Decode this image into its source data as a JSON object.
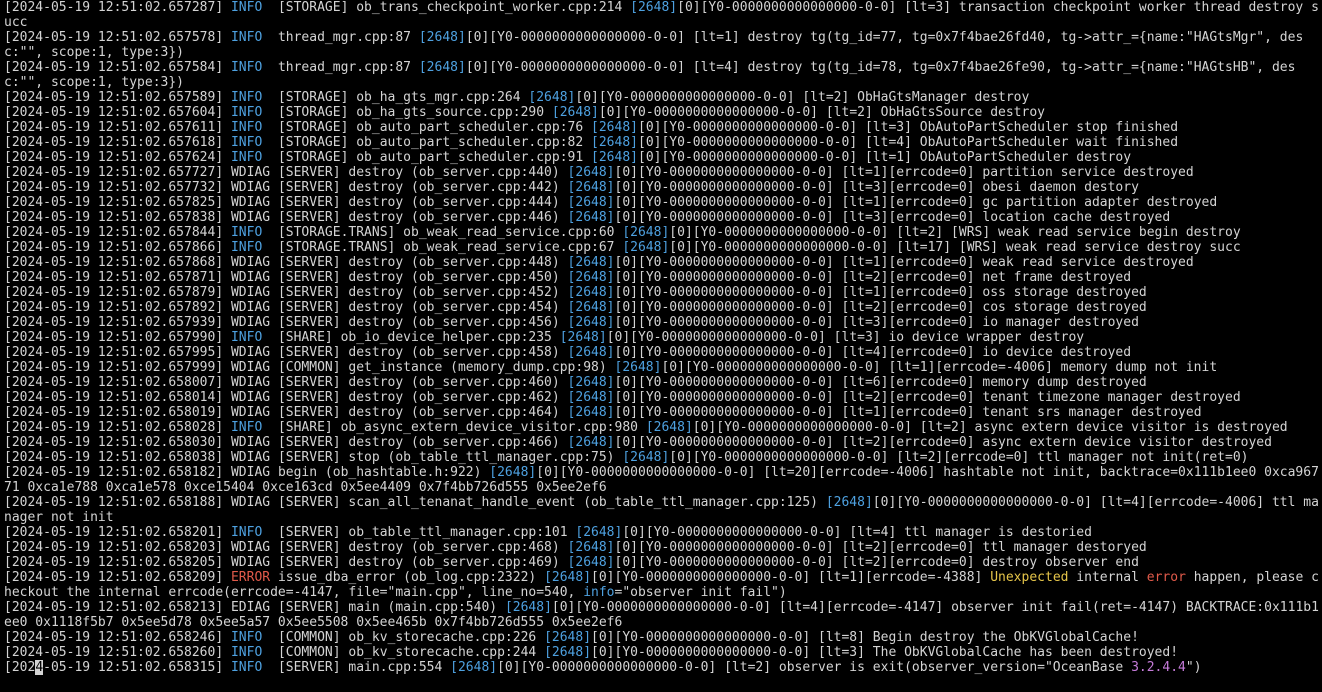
{
  "colors": {
    "background": "#000000",
    "text": "#d4d4d4",
    "info": "#4ea1e0",
    "error": "#e05a4a",
    "highlight_yellow": "#e5c54a",
    "highlight_purple": "#c57bd9"
  },
  "lines": [
    {
      "ts": "[2024-05-19 12:51:02.657287]",
      "lvl": "INFO",
      "lvlClass": "info",
      "pad": "  ",
      "pre": "[STORAGE] ob_trans_checkpoint_worker.cpp:214 ",
      "tid": "[2648]",
      "post": "[0][Y0-0000000000000000-0-0] [lt=3] transaction checkpoint worker thread destroy succ"
    },
    {
      "ts": "[2024-05-19 12:51:02.657578]",
      "lvl": "INFO",
      "lvlClass": "info",
      "pad": "  ",
      "pre": "thread_mgr.cpp:87 ",
      "tid": "[2648]",
      "post": "[0][Y0-0000000000000000-0-0] [lt=1] destroy tg(tg_id=77, tg=0x7f4bae26fd40, tg->attr_={name:\"HAGtsMgr\", desc:\"\", scope:1, type:3})"
    },
    {
      "ts": "[2024-05-19 12:51:02.657584]",
      "lvl": "INFO",
      "lvlClass": "info",
      "pad": "  ",
      "pre": "thread_mgr.cpp:87 ",
      "tid": "[2648]",
      "post": "[0][Y0-0000000000000000-0-0] [lt=4] destroy tg(tg_id=78, tg=0x7f4bae26fe90, tg->attr_={name:\"HAGtsHB\", desc:\"\", scope:1, type:3})"
    },
    {
      "ts": "[2024-05-19 12:51:02.657589]",
      "lvl": "INFO",
      "lvlClass": "info",
      "pad": "  ",
      "pre": "[STORAGE] ob_ha_gts_mgr.cpp:264 ",
      "tid": "[2648]",
      "post": "[0][Y0-0000000000000000-0-0] [lt=2] ObHaGtsManager destroy"
    },
    {
      "ts": "[2024-05-19 12:51:02.657604]",
      "lvl": "INFO",
      "lvlClass": "info",
      "pad": "  ",
      "pre": "[STORAGE] ob_ha_gts_source.cpp:290 ",
      "tid": "[2648]",
      "post": "[0][Y0-0000000000000000-0-0] [lt=2] ObHaGtsSource destroy"
    },
    {
      "ts": "[2024-05-19 12:51:02.657611]",
      "lvl": "INFO",
      "lvlClass": "info",
      "pad": "  ",
      "pre": "[STORAGE] ob_auto_part_scheduler.cpp:76 ",
      "tid": "[2648]",
      "post": "[0][Y0-0000000000000000-0-0] [lt=3] ObAutoPartScheduler stop finished"
    },
    {
      "ts": "[2024-05-19 12:51:02.657618]",
      "lvl": "INFO",
      "lvlClass": "info",
      "pad": "  ",
      "pre": "[STORAGE] ob_auto_part_scheduler.cpp:82 ",
      "tid": "[2648]",
      "post": "[0][Y0-0000000000000000-0-0] [lt=4] ObAutoPartScheduler wait finished"
    },
    {
      "ts": "[2024-05-19 12:51:02.657624]",
      "lvl": "INFO",
      "lvlClass": "info",
      "pad": "  ",
      "pre": "[STORAGE] ob_auto_part_scheduler.cpp:91 ",
      "tid": "[2648]",
      "post": "[0][Y0-0000000000000000-0-0] [lt=1] ObAutoPartScheduler destroy"
    },
    {
      "ts": "[2024-05-19 12:51:02.657727]",
      "lvl": "WDIAG",
      "lvlClass": "wdiag",
      "pad": " ",
      "pre": "[SERVER] destroy (ob_server.cpp:440) ",
      "tid": "[2648]",
      "post": "[0][Y0-0000000000000000-0-0] [lt=1][errcode=0] partition service destroyed"
    },
    {
      "ts": "[2024-05-19 12:51:02.657732]",
      "lvl": "WDIAG",
      "lvlClass": "wdiag",
      "pad": " ",
      "pre": "[SERVER] destroy (ob_server.cpp:442) ",
      "tid": "[2648]",
      "post": "[0][Y0-0000000000000000-0-0] [lt=3][errcode=0] obesi daemon destory"
    },
    {
      "ts": "[2024-05-19 12:51:02.657825]",
      "lvl": "WDIAG",
      "lvlClass": "wdiag",
      "pad": " ",
      "pre": "[SERVER] destroy (ob_server.cpp:444) ",
      "tid": "[2648]",
      "post": "[0][Y0-0000000000000000-0-0] [lt=1][errcode=0] gc partition adapter destroyed"
    },
    {
      "ts": "[2024-05-19 12:51:02.657838]",
      "lvl": "WDIAG",
      "lvlClass": "wdiag",
      "pad": " ",
      "pre": "[SERVER] destroy (ob_server.cpp:446) ",
      "tid": "[2648]",
      "post": "[0][Y0-0000000000000000-0-0] [lt=3][errcode=0] location cache destroyed"
    },
    {
      "ts": "[2024-05-19 12:51:02.657844]",
      "lvl": "INFO",
      "lvlClass": "info",
      "pad": "  ",
      "pre": "[STORAGE.TRANS] ob_weak_read_service.cpp:60 ",
      "tid": "[2648]",
      "post": "[0][Y0-0000000000000000-0-0] [lt=2] [WRS] weak read service begin destroy"
    },
    {
      "ts": "[2024-05-19 12:51:02.657866]",
      "lvl": "INFO",
      "lvlClass": "info",
      "pad": "  ",
      "pre": "[STORAGE.TRANS] ob_weak_read_service.cpp:67 ",
      "tid": "[2648]",
      "post": "[0][Y0-0000000000000000-0-0] [lt=17] [WRS] weak read service destroy succ"
    },
    {
      "ts": "[2024-05-19 12:51:02.657868]",
      "lvl": "WDIAG",
      "lvlClass": "wdiag",
      "pad": " ",
      "pre": "[SERVER] destroy (ob_server.cpp:448) ",
      "tid": "[2648]",
      "post": "[0][Y0-0000000000000000-0-0] [lt=1][errcode=0] weak read service destroyed"
    },
    {
      "ts": "[2024-05-19 12:51:02.657871]",
      "lvl": "WDIAG",
      "lvlClass": "wdiag",
      "pad": " ",
      "pre": "[SERVER] destroy (ob_server.cpp:450) ",
      "tid": "[2648]",
      "post": "[0][Y0-0000000000000000-0-0] [lt=2][errcode=0] net frame destroyed"
    },
    {
      "ts": "[2024-05-19 12:51:02.657879]",
      "lvl": "WDIAG",
      "lvlClass": "wdiag",
      "pad": " ",
      "pre": "[SERVER] destroy (ob_server.cpp:452) ",
      "tid": "[2648]",
      "post": "[0][Y0-0000000000000000-0-0] [lt=1][errcode=0] oss storage destroyed"
    },
    {
      "ts": "[2024-05-19 12:51:02.657892]",
      "lvl": "WDIAG",
      "lvlClass": "wdiag",
      "pad": " ",
      "pre": "[SERVER] destroy (ob_server.cpp:454) ",
      "tid": "[2648]",
      "post": "[0][Y0-0000000000000000-0-0] [lt=2][errcode=0] cos storage destroyed"
    },
    {
      "ts": "[2024-05-19 12:51:02.657939]",
      "lvl": "WDIAG",
      "lvlClass": "wdiag",
      "pad": " ",
      "pre": "[SERVER] destroy (ob_server.cpp:456) ",
      "tid": "[2648]",
      "post": "[0][Y0-0000000000000000-0-0] [lt=3][errcode=0] io manager destroyed"
    },
    {
      "ts": "[2024-05-19 12:51:02.657990]",
      "lvl": "INFO",
      "lvlClass": "info",
      "pad": "  ",
      "pre": "[SHARE] ob_io_device_helper.cpp:235 ",
      "tid": "[2648]",
      "post": "[0][Y0-0000000000000000-0-0] [lt=3] io device wrapper destroy"
    },
    {
      "ts": "[2024-05-19 12:51:02.657995]",
      "lvl": "WDIAG",
      "lvlClass": "wdiag",
      "pad": " ",
      "pre": "[SERVER] destroy (ob_server.cpp:458) ",
      "tid": "[2648]",
      "post": "[0][Y0-0000000000000000-0-0] [lt=4][errcode=0] io device destroyed"
    },
    {
      "ts": "[2024-05-19 12:51:02.657999]",
      "lvl": "WDIAG",
      "lvlClass": "wdiag",
      "pad": " ",
      "pre": "[COMMON] get_instance (memory_dump.cpp:98) ",
      "tid": "[2648]",
      "post": "[0][Y0-0000000000000000-0-0] [lt=1][errcode=-4006] memory dump not init"
    },
    {
      "ts": "[2024-05-19 12:51:02.658007]",
      "lvl": "WDIAG",
      "lvlClass": "wdiag",
      "pad": " ",
      "pre": "[SERVER] destroy (ob_server.cpp:460) ",
      "tid": "[2648]",
      "post": "[0][Y0-0000000000000000-0-0] [lt=6][errcode=0] memory dump destroyed"
    },
    {
      "ts": "[2024-05-19 12:51:02.658014]",
      "lvl": "WDIAG",
      "lvlClass": "wdiag",
      "pad": " ",
      "pre": "[SERVER] destroy (ob_server.cpp:462) ",
      "tid": "[2648]",
      "post": "[0][Y0-0000000000000000-0-0] [lt=2][errcode=0] tenant timezone manager destroyed"
    },
    {
      "ts": "[2024-05-19 12:51:02.658019]",
      "lvl": "WDIAG",
      "lvlClass": "wdiag",
      "pad": " ",
      "pre": "[SERVER] destroy (ob_server.cpp:464) ",
      "tid": "[2648]",
      "post": "[0][Y0-0000000000000000-0-0] [lt=1][errcode=0] tenant srs manager destroyed"
    },
    {
      "ts": "[2024-05-19 12:51:02.658028]",
      "lvl": "INFO",
      "lvlClass": "info",
      "pad": "  ",
      "pre": "[SHARE] ob_async_extern_device_visitor.cpp:980 ",
      "tid": "[2648]",
      "post": "[0][Y0-0000000000000000-0-0] [lt=2] async extern device visitor is destroyed"
    },
    {
      "ts": "[2024-05-19 12:51:02.658030]",
      "lvl": "WDIAG",
      "lvlClass": "wdiag",
      "pad": " ",
      "pre": "[SERVER] destroy (ob_server.cpp:466) ",
      "tid": "[2648]",
      "post": "[0][Y0-0000000000000000-0-0] [lt=2][errcode=0] async extern device visitor destroyed"
    },
    {
      "ts": "[2024-05-19 12:51:02.658038]",
      "lvl": "WDIAG",
      "lvlClass": "wdiag",
      "pad": " ",
      "pre": "[SERVER] stop (ob_table_ttl_manager.cpp:75) ",
      "tid": "[2648]",
      "post": "[0][Y0-0000000000000000-0-0] [lt=2][errcode=0] ttl manager not init(ret=0)"
    },
    {
      "ts": "[2024-05-19 12:51:02.658182]",
      "lvl": "WDIAG",
      "lvlClass": "wdiag",
      "pad": " ",
      "pre": "begin (ob_hashtable.h:922) ",
      "tid": "[2648]",
      "post": "[0][Y0-0000000000000000-0-0] [lt=20][errcode=-4006] hashtable not init, backtrace=0x111b1ee0 0xca96771 0xca1e788 0xca1e578 0xce15404 0xce163cd 0x5ee4409 0x7f4bb726d555 0x5ee2ef6"
    },
    {
      "ts": "[2024-05-19 12:51:02.658188]",
      "lvl": "WDIAG",
      "lvlClass": "wdiag",
      "pad": " ",
      "pre": "[SERVER] scan_all_tenanat_handle_event (ob_table_ttl_manager.cpp:125) ",
      "tid": "[2648]",
      "post": "[0][Y0-0000000000000000-0-0] [lt=4][errcode=-4006] ttl manager not init"
    },
    {
      "ts": "[2024-05-19 12:51:02.658201]",
      "lvl": "INFO",
      "lvlClass": "info",
      "pad": "  ",
      "pre": "[SERVER] ob_table_ttl_manager.cpp:101 ",
      "tid": "[2648]",
      "post": "[0][Y0-0000000000000000-0-0] [lt=4] ttl manager is destoried"
    },
    {
      "ts": "[2024-05-19 12:51:02.658203]",
      "lvl": "WDIAG",
      "lvlClass": "wdiag",
      "pad": " ",
      "pre": "[SERVER] destroy (ob_server.cpp:468) ",
      "tid": "[2648]",
      "post": "[0][Y0-0000000000000000-0-0] [lt=2][errcode=0] ttl manager destoryed"
    },
    {
      "ts": "[2024-05-19 12:51:02.658205]",
      "lvl": "WDIAG",
      "lvlClass": "wdiag",
      "pad": " ",
      "pre": "[SERVER] destroy (ob_server.cpp:469) ",
      "tid": "[2648]",
      "post": "[0][Y0-0000000000000000-0-0] [lt=2][errcode=0] destroy observer end"
    },
    {
      "ts": "[2024-05-19 12:51:02.658209]",
      "lvl": "ERROR",
      "lvlClass": "error",
      "pad": " ",
      "pre": "issue_dba_error (ob_log.cpp:2322) ",
      "tid": "[2648]",
      "post": "[0][Y0-0000000000000000-0-0] [lt=1][errcode=-4388] ",
      "special": "error"
    },
    {
      "ts": "[2024-05-19 12:51:02.658213]",
      "lvl": "EDIAG",
      "lvlClass": "ediag",
      "pad": " ",
      "pre": "[SERVER] main (main.cpp:540) ",
      "tid": "[2648]",
      "post": "[0][Y0-0000000000000000-0-0] [lt=4][errcode=-4147] observer init fail(ret=-4147) BACKTRACE:0x111b1ee0 0x1118f5b7 0x5ee5d78 0x5ee5a57 0x5ee5508 0x5ee465b 0x7f4bb726d555 0x5ee2ef6"
    },
    {
      "ts": "[2024-05-19 12:51:02.658246]",
      "lvl": "INFO",
      "lvlClass": "info",
      "pad": "  ",
      "pre": "[COMMON] ob_kv_storecache.cpp:226 ",
      "tid": "[2648]",
      "post": "[0][Y0-0000000000000000-0-0] [lt=8] Begin destroy the ObKVGlobalCache!"
    },
    {
      "ts": "[2024-05-19 12:51:02.658260]",
      "lvl": "INFO",
      "lvlClass": "info",
      "pad": "  ",
      "pre": "[COMMON] ob_kv_storecache.cpp:244 ",
      "tid": "[2648]",
      "post": "[0][Y0-0000000000000000-0-0] [lt=3] The ObKVGlobalCache has been destroyed!"
    },
    {
      "ts": "[2024-05-19 12:51:02.658315]",
      "lvl": "INFO",
      "lvlClass": "info",
      "pad": "  ",
      "pre": "[SERVER] main.cpp:554 ",
      "tid": "[2648]",
      "post": "[0][Y0-0000000000000000-0-0] [lt=2] observer is exit(observer_version=\"OceanBase ",
      "special": "last"
    }
  ],
  "error_line": {
    "unexpected": "Unexpected",
    "internal": " internal ",
    "error_word": "error",
    "rest": " happen, please checkout the internal errcode(errcode=-4147, file=\"main.cpp\", line_no=540, ",
    "info_word": "info",
    "tail": "=\"observer init fail\")"
  },
  "last_line": {
    "version": "3.2.4.4",
    "tail": "\")"
  }
}
